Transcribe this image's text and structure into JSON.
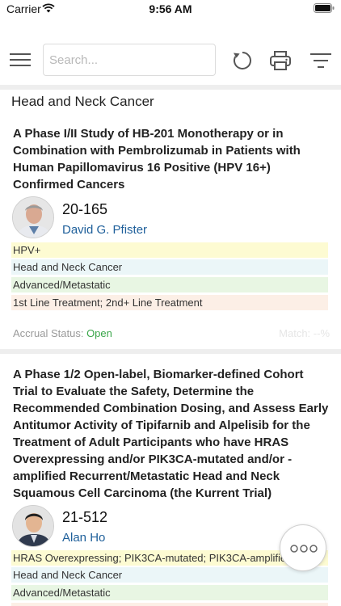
{
  "status_bar": {
    "carrier": "Carrier",
    "time": "9:56 AM"
  },
  "toolbar": {
    "search_placeholder": "Search..."
  },
  "section": {
    "title": "Head and Neck Cancer"
  },
  "trials": [
    {
      "title": "A Phase I/II Study of HB-201 Monotherapy or in Combination with Pembrolizumab in Patients with Human Papillomavirus 16 Positive (HPV 16+) Confirmed Cancers",
      "id": "20-165",
      "pi": "David G. Pfister",
      "tags": [
        "HPV+",
        "Head and Neck Cancer",
        "Advanced/Metastatic",
        "1st Line Treatment; 2nd+ Line Treatment"
      ],
      "accrual_label": "Accrual Status:",
      "accrual_value": "Open",
      "match": "Match: --%"
    },
    {
      "title": "A Phase 1/2 Open-label, Biomarker-defined Cohort Trial to Evaluate the Safety, Determine the Recommended Combination Dosing, and Assess Early Antitumor Activity of Tipifarnib and Alpelisib for the Treatment of Adult Participants who have HRAS Overexpressing and/or PIK3CA-mutated and/or -amplified Recurrent/Metastatic Head and Neck Squamous Cell Carcinoma (the Kurrent Trial)",
      "id": "21-512",
      "pi": "Alan Ho",
      "tags": [
        "HRAS Overexpressing; PIK3CA-mutated; PIK3CA-amplified",
        "Head and Neck Cancer",
        "Advanced/Metastatic"
      ]
    }
  ],
  "colors": {
    "link": "#1e5f9a",
    "open_status": "#3aa64a",
    "tag_yellow": "#fdfbd2",
    "tag_blue": "#ebf6f8",
    "tag_green": "#e8f6e3",
    "tag_pink": "#fcefe6"
  },
  "icons": [
    "wifi-icon",
    "battery-icon",
    "menu-icon",
    "refresh-icon",
    "print-icon",
    "filter-icon",
    "more-icon"
  ]
}
